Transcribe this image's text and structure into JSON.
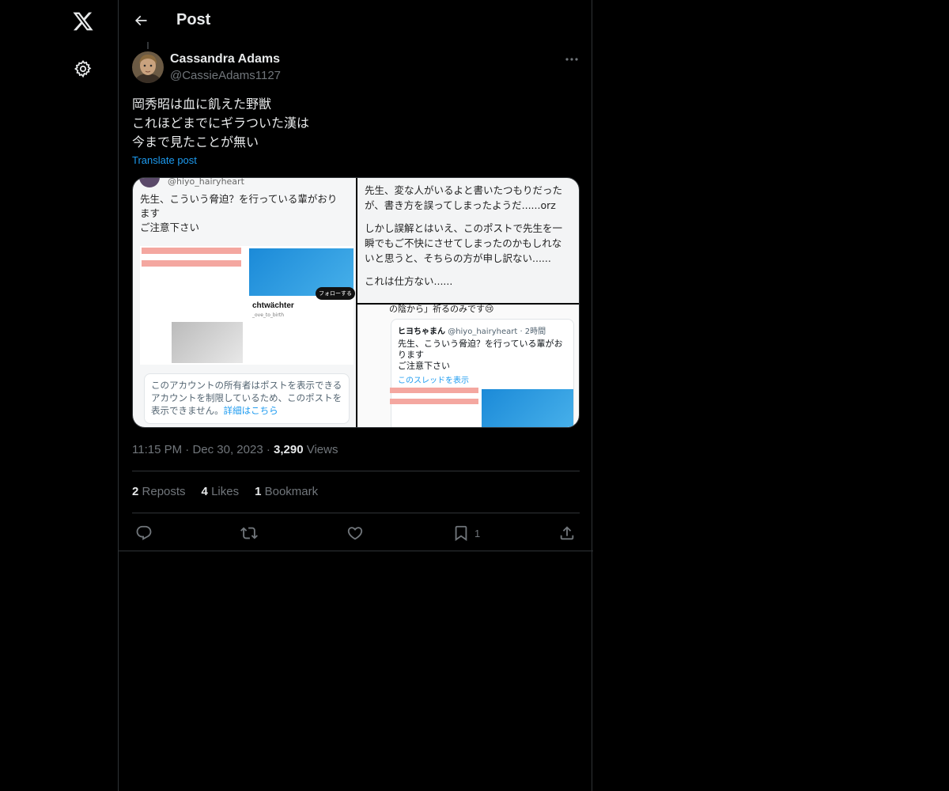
{
  "header": {
    "title": "Post"
  },
  "post": {
    "author_name": "Cassandra Adams",
    "author_handle": "@CassieAdams1127",
    "text_lines": [
      "岡秀昭は血に飢えた野獣",
      "これほどまでにギラついた漢は",
      "今まで見たことが無い"
    ],
    "translate_label": "Translate post",
    "time": "11:15 PM",
    "date": "Dec 30, 2023",
    "views_count": "3,290",
    "views_label": "Views",
    "dot": "·",
    "stats": {
      "reposts_count": "2",
      "reposts_label": "Reposts",
      "likes_count": "4",
      "likes_label": "Likes",
      "bookmarks_count": "1",
      "bookmarks_label": "Bookmark"
    },
    "bookmark_action_count": "1"
  },
  "media": {
    "image1": {
      "handle": "@hiyo_hairyheart",
      "lines": [
        "先生、こういう脅迫？を行っている輩がおり",
        "ます",
        "ご注意下さい"
      ],
      "card_name": "chtwächter",
      "card_sub": "_ove_to_birth",
      "follow_label": "フォローする",
      "notice_text": "このアカウントの所有者はポストを表示できるアカウントを制限しているため、このポストを表示できません。",
      "notice_link": "詳細はこちら"
    },
    "image2": {
      "lines": [
        "先生、変な人がいるよと書いたつもりだった",
        "が、書き方を誤ってしまったようだ......orz",
        "",
        "しかし誤解とはいえ、このポストで先生を一",
        "瞬でもご不快にさせてしまったのかもしれな",
        "いと思うと、そちらの方が申し訳ない......",
        "",
        "これは仕方ない......"
      ]
    },
    "image3": {
      "top_line": "の陰から」祈るのみです😢",
      "quote_name": "ヒヨちゃまん",
      "quote_handle": "@hiyo_hairyheart · 2時間",
      "quote_lines": [
        "先生、こういう脅迫？を行っている輩がお",
        "ります",
        "ご注意下さい"
      ],
      "quote_link": "このスレッドを表示"
    }
  },
  "icons": {
    "logo": "x-logo-icon",
    "settings": "gear-icon",
    "back": "arrow-left-icon",
    "more": "more-dots-icon",
    "reply": "reply-icon",
    "repost": "repost-icon",
    "like": "heart-icon",
    "bookmark": "bookmark-icon",
    "share": "share-icon"
  },
  "colors": {
    "background": "#000000",
    "text": "#e7e9ea",
    "secondary": "#71767b",
    "accent": "#1d9bf0",
    "border": "#2f3336"
  }
}
